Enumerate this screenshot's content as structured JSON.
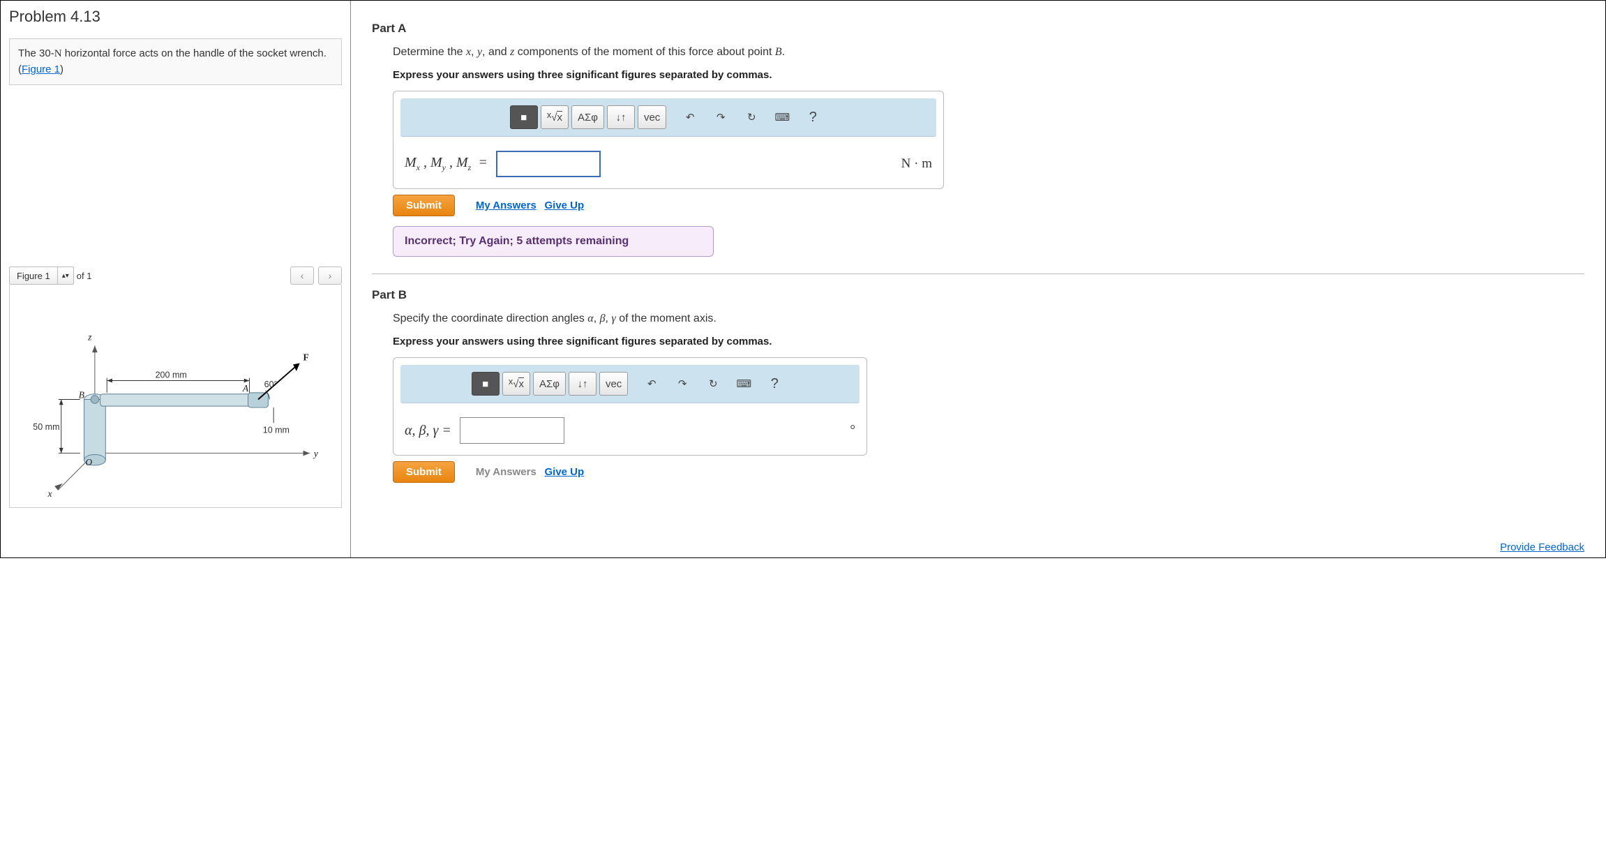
{
  "problem": {
    "title": "Problem 4.13",
    "description_prefix": "The 30-",
    "force_unit": "N",
    "description_mid": " horizontal force acts on the handle of the socket wrench. (",
    "figure_link": "Figure 1",
    "description_suffix": ")"
  },
  "figure_panel": {
    "label": "Figure 1",
    "of_text": "of 1",
    "prev": "‹",
    "next": "›",
    "dims": {
      "length": "200 mm",
      "height": "50 mm",
      "thickness": "10 mm",
      "angle": "60°"
    },
    "axes": {
      "x": "x",
      "y": "y",
      "z": "z"
    },
    "points": {
      "A": "A",
      "B": "B",
      "O": "O",
      "F": "F"
    }
  },
  "partA": {
    "label": "Part A",
    "prompt_prefix": "Determine the ",
    "var_x": "x",
    "prompt_sep1": ", ",
    "var_y": "y",
    "prompt_sep2": ", and ",
    "var_z": "z",
    "prompt_mid": " components of the moment of this force about point ",
    "var_B": "B",
    "prompt_end": ".",
    "instructions": "Express your answers using three significant figures separated by commas.",
    "answer_label_html": "M_x , M_y , M_z =",
    "unit": "N · m",
    "submit": "Submit",
    "my_answers": "My Answers",
    "give_up": "Give Up",
    "feedback": "Incorrect; Try Again; 5 attempts remaining"
  },
  "partB": {
    "label": "Part B",
    "prompt_prefix": "Specify the coordinate direction angles ",
    "var_a": "α",
    "sep1": ", ",
    "var_b": "β",
    "sep2": ", ",
    "var_g": "γ",
    "prompt_suffix": " of the moment axis.",
    "instructions": "Express your answers using three significant figures separated by commas.",
    "answer_label": "α, β, γ =",
    "unit": "°",
    "submit": "Submit",
    "my_answers": "My Answers",
    "give_up": "Give Up"
  },
  "toolbar": {
    "templates": "■",
    "sqrt": "√",
    "greek": "ΑΣφ",
    "scripts": "↓↑",
    "vec": "vec",
    "undo": "↶",
    "redo": "↷",
    "reset": "↻",
    "keyboard": "⌨",
    "help": "?"
  },
  "footer": {
    "provide_feedback": "Provide Feedback"
  }
}
